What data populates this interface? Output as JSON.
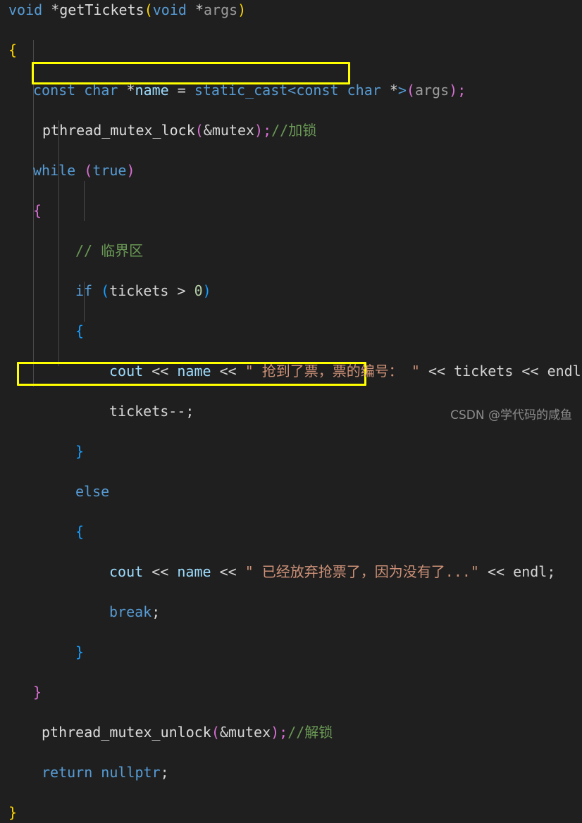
{
  "editor": {
    "background": "#1f1f1f",
    "language": "cpp",
    "code_lines": [
      "void *getTickets(void *args)",
      "{",
      "    const char *name = static_cast<const char *>(args);",
      "    pthread_mutex_lock(&mutex);//加锁",
      "    while (true)",
      "    {",
      "        // 临界区",
      "        if (tickets > 0)",
      "        {",
      "            cout << name << \" 抢到了票，票的编号： \" << tickets << endl;",
      "            tickets--;",
      "        }",
      "        else",
      "        {",
      "            cout << name << \" 已经放弃抢票了，因为没有了...\" << endl;",
      "            break;",
      "        }",
      "    }",
      "    pthread_mutex_unlock(&mutex);//解锁",
      "    return nullptr;",
      "}"
    ],
    "tokens": {
      "t_void": "void",
      "t_star": "*",
      "t_getTickets": "getTickets",
      "t_lparen_y": "(",
      "t_rparen_y": ")",
      "t_args": "args",
      "t_brace_open_fn": "{",
      "t_brace_close_fn": "}",
      "t_const": "const",
      "t_char": "char",
      "t_name": "name",
      "t_eq": "=",
      "t_static_cast": "static_cast",
      "t_lt": "<",
      "t_gt": ">",
      "t_semi": ";",
      "t_pthread_lock": "pthread_mutex_lock",
      "t_pthread_unlock": "pthread_mutex_unlock",
      "t_amp_mutex": "&mutex",
      "t_comment_lock": "//加锁",
      "t_comment_unlock": "//解锁",
      "t_while": "while",
      "t_true": "true",
      "t_brace_open_while": "{",
      "t_brace_close_while": "}",
      "t_comment_critical": "// 临界区",
      "t_if": "if",
      "t_tickets": "tickets",
      "t_gt_cmp": ">",
      "t_zero": "0",
      "t_brace_open_if": "{",
      "t_brace_close_if": "}",
      "t_cout": "cout",
      "t_shift": "<<",
      "t_str_got": "\" 抢到了票，票的编号： \"",
      "t_endl": "endl",
      "t_tickets_dec": "tickets--",
      "t_else": "else",
      "t_brace_open_else": "{",
      "t_brace_close_else": "}",
      "t_str_gave_up": "\" 已经放弃抢票了，因为没有了...\"",
      "t_break": "break",
      "t_return": "return",
      "t_nullptr": "nullptr"
    },
    "highlights": [
      {
        "name": "lock-highlight",
        "label": "pthread_mutex_lock highlight"
      },
      {
        "name": "unlock-highlight",
        "label": "pthread_mutex_unlock highlight"
      }
    ],
    "colors": {
      "background": "#1f1f1f",
      "keyword": "#569cd6",
      "string": "#ce9178",
      "comment": "#6a9955",
      "number": "#b5cea8",
      "variable": "#9cdcfe",
      "parameter": "#9c9c9c",
      "plain": "#d4d4d4",
      "bracket_yellow": "#ffd700",
      "bracket_pink": "#da70d6",
      "bracket_blue": "#179fff",
      "highlight_box": "#ffff00"
    }
  },
  "watermark": {
    "text": "CSDN @学代码的咸鱼"
  }
}
